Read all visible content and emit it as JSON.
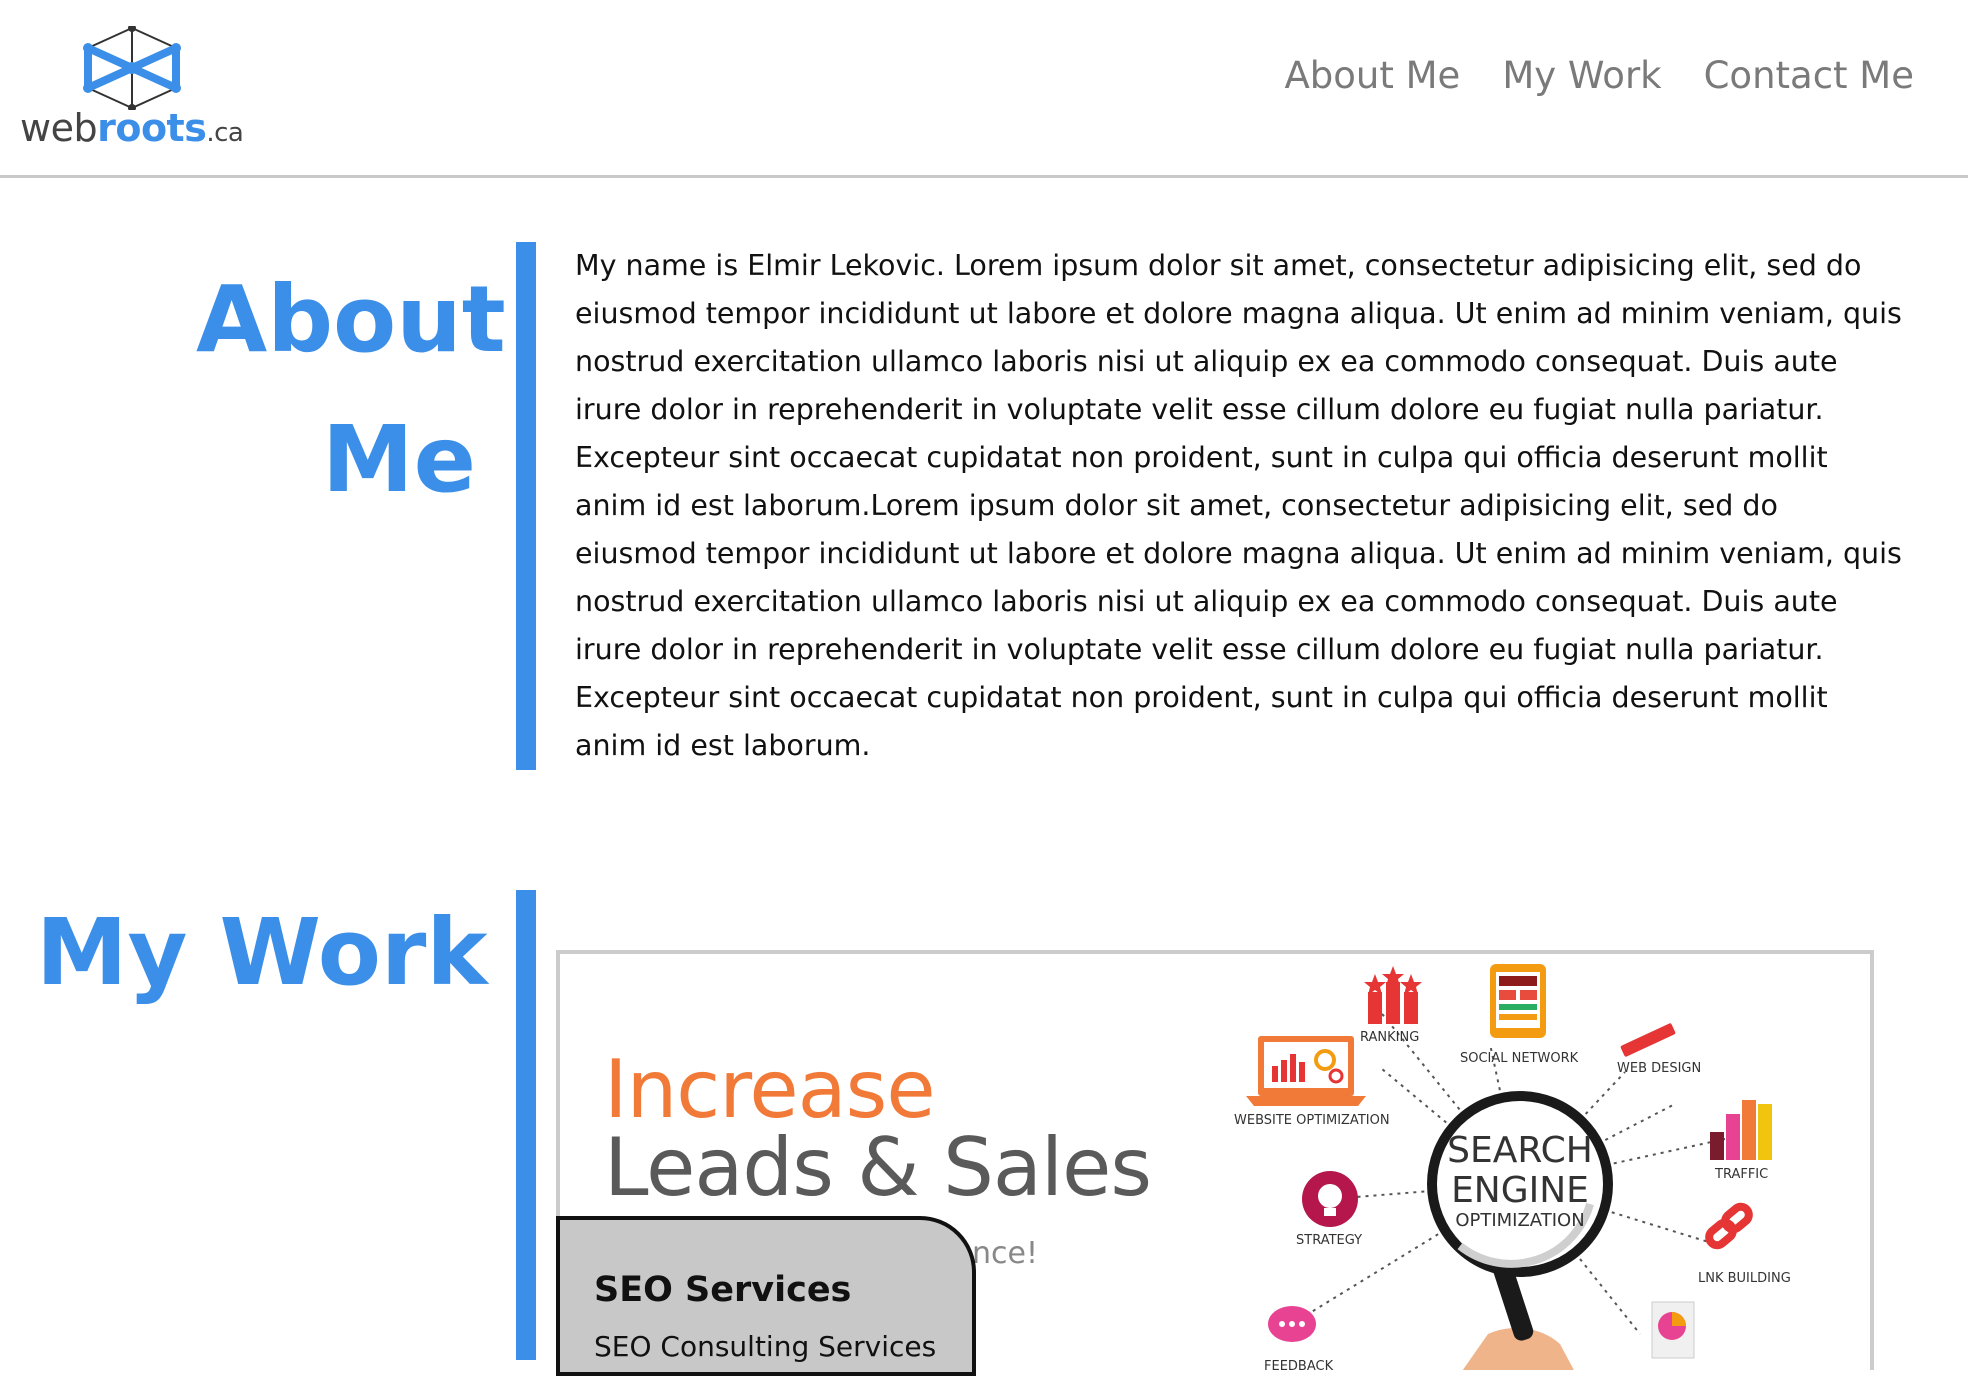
{
  "header": {
    "logo": {
      "prefix": "web",
      "highlight": "roots",
      "suffix": ".ca"
    },
    "nav": [
      {
        "label": "About Me"
      },
      {
        "label": "My Work"
      },
      {
        "label": "Contact Me"
      }
    ]
  },
  "about": {
    "title_line1": "About",
    "title_line2": "Me",
    "body": "My name is Elmir Lekovic. Lorem ipsum dolor sit amet, consectetur adipisicing elit, sed do eiusmod tempor incididunt ut labore et dolore magna aliqua. Ut enim ad minim veniam, quis nostrud exercitation ullamco laboris nisi ut aliquip ex ea commodo consequat. Duis aute irure dolor in reprehenderit in voluptate velit esse cillum dolore eu fugiat nulla pariatur. Excepteur sint occaecat cupidatat non proident, sunt in culpa qui officia deserunt mollit anim id est laborum.Lorem ipsum dolor sit amet, consectetur adipisicing elit, sed do eiusmod tempor incididunt ut labore et dolore magna aliqua. Ut enim ad minim veniam, quis nostrud exercitation ullamco laboris nisi ut aliquip ex ea commodo consequat. Duis aute irure dolor in reprehenderit in voluptate velit esse cillum dolore eu fugiat nulla pariatur. Excepteur sint occaecat cupidatat non proident, sunt in culpa qui officia deserunt mollit anim id est laborum."
  },
  "work": {
    "title": "My Work",
    "project": {
      "image": {
        "headline_line1": "Increase",
        "headline_line2": "Leads & Sales",
        "subline_fragment": "nce!",
        "center_line1": "SEARCH",
        "center_line2": "ENGINE",
        "center_line3": "OPTIMIZATION",
        "labels": {
          "ranking": "RANKING",
          "social_network": "SOCIAL NETWORK",
          "web_design": "WEB DESIGN",
          "website_optimization": "WEBSITE OPTIMIZATION",
          "traffic": "TRAFFIC",
          "strategy": "STRATEGY",
          "link_building": "LNK BUILDING",
          "feedback": "FEEDBACK"
        }
      },
      "overlay_title": "SEO Services",
      "overlay_subtitle": "SEO Consulting Services"
    }
  },
  "colors": {
    "accent": "#3b8fe8",
    "orange": "#f27a38",
    "nav_text": "#7a7a7a",
    "overlay_bg": "#c8c8c8"
  }
}
